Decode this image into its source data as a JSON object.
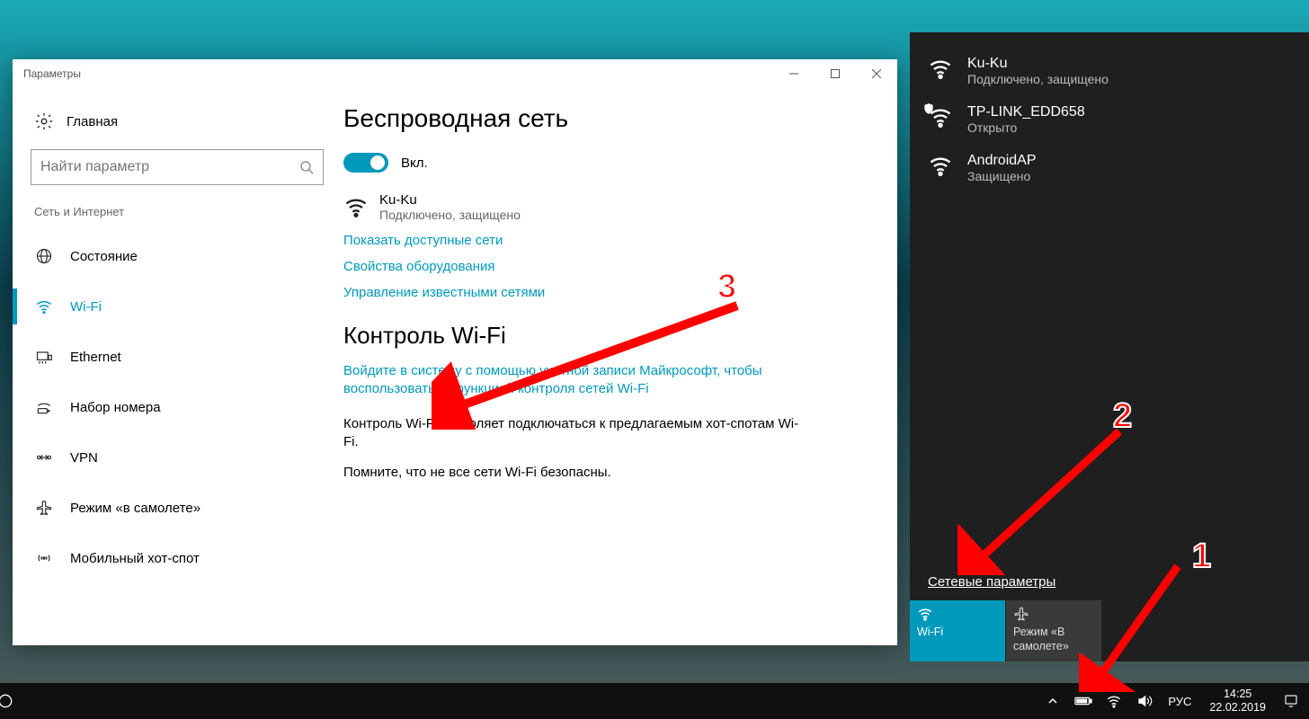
{
  "window": {
    "title": "Параметры"
  },
  "sidebar": {
    "home": "Главная",
    "search_placeholder": "Найти параметр",
    "section": "Сеть и Интернет",
    "items": [
      {
        "label": "Состояние"
      },
      {
        "label": "Wi-Fi"
      },
      {
        "label": "Ethernet"
      },
      {
        "label": "Набор номера"
      },
      {
        "label": "VPN"
      },
      {
        "label": "Режим «в самолете»"
      },
      {
        "label": "Мобильный хот-спот"
      }
    ]
  },
  "content": {
    "heading": "Беспроводная сеть",
    "toggle_label": "Вкл.",
    "network": {
      "name": "Ku-Ku",
      "status": "Подключено, защищено"
    },
    "links": {
      "show": "Показать доступные сети",
      "hardware": "Свойства оборудования",
      "manage": "Управление известными сетями"
    },
    "section2": "Контроль Wi-Fi",
    "signin": "Войдите в систему с помощью учетной записи Майкрософт, чтобы воспользоваться функцией контроля сетей Wi-Fi",
    "desc": "Контроль Wi-Fi позволяет подключаться к предлагаемым хот-спотам Wi-Fi.",
    "warn": "Помните, что не все сети Wi-Fi безопасны."
  },
  "flyout": {
    "nets": [
      {
        "name": "Ku-Ku",
        "status": "Подключено, защищено"
      },
      {
        "name": "TP-LINK_EDD658",
        "status": "Открыто"
      },
      {
        "name": "AndroidAP",
        "status": "Защищено"
      }
    ],
    "settings_link": "Сетевые параметры",
    "tiles": {
      "wifi": "Wi-Fi",
      "airplane": "Режим «В самолете»"
    }
  },
  "taskbar": {
    "lang": "РУС",
    "time": "14:25",
    "date": "22.02.2019"
  },
  "annotations": {
    "n1": "1",
    "n2": "2",
    "n3": "3"
  }
}
